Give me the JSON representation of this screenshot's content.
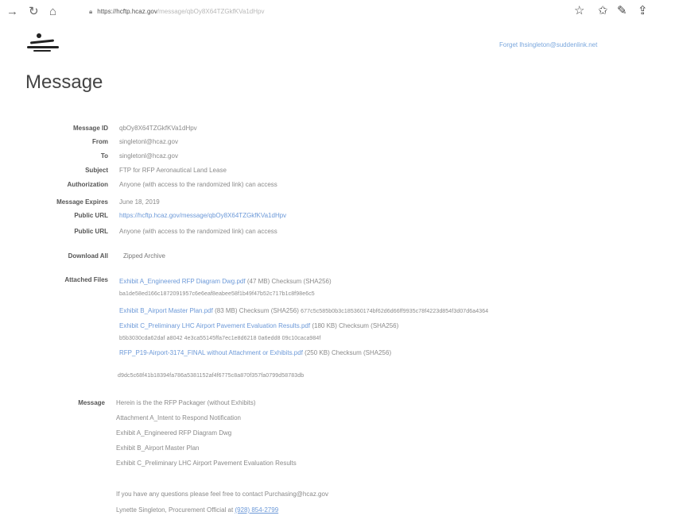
{
  "browser": {
    "url_host": "https://hcftp.hcaz.gov",
    "url_rest": "/message/qbOy8X64TZGkfKVa1dHpv"
  },
  "header": {
    "user_link": "Forget lhsingleton@suddenlink.net"
  },
  "page": {
    "title": "Message"
  },
  "fields": {
    "message_id": {
      "label": "Message ID",
      "value": "qbOy8X64TZGkfKVa1dHpv"
    },
    "from": {
      "label": "From",
      "value": "singletonl@hcaz.gov"
    },
    "to": {
      "label": "To",
      "value": "singletonl@hcaz.gov"
    },
    "subject": {
      "label": "Subject",
      "value": "FTP for RFP Aeronautical Land Lease"
    },
    "authorization": {
      "label": "Authorization",
      "value": "Anyone (with access to the randomized link) can access"
    },
    "expires": {
      "label": "Message Expires",
      "value": "June 18, 2019"
    },
    "public_url": {
      "label": "Public URL",
      "value": "https://hcftp.hcaz.gov/message/qbOy8X64TZGkfKVa1dHpv"
    },
    "public_url_2": {
      "label": "Public URL",
      "value": "Anyone (with access to the randomized link) can access"
    },
    "download_all": {
      "label": "Download All",
      "value": "Zipped Archive"
    }
  },
  "attached": {
    "label": "Attached Files",
    "files": [
      {
        "name": "Exhibit A_Engineered RFP Diagram Dwg.pdf",
        "meta": "(47 MB) Checksum (SHA256)",
        "hash": "ba1de58ed166c1872091957c6e6eaf8eabee58f1b49f47b52c717b1c8f98e6c5"
      },
      {
        "name": "Exhibit B_Airport Master Plan.pdf",
        "meta": "(83 MB) Checksum (SHA256)",
        "hash": "677c5c585b0b3c185360174bf62d6d66ff9935c78f4223d854f3d07d6a4364"
      },
      {
        "name": "Exhibit C_Preliminary LHC Airport Pavement Evaluation Results.pdf",
        "meta": "(180 KB) Checksum (SHA256)",
        "hash": "b5b3030cda62daf a8042 4e3ca55145ffa7ec1e8d6218 0a6edd8 09c10caca984f"
      },
      {
        "name": "RFP_P19-Airport-3174_FINAL without Attachment or Exhibits.pdf",
        "meta": "(250 KB) Checksum (SHA256)",
        "hash": "d9dc5c68f41b18394fa786a5381152af4f6775c8a870f357fa0799d58783db"
      }
    ]
  },
  "message": {
    "label": "Message",
    "lines": [
      "Herein is the the RFP Packager (without Exhibits)",
      "Attachment A_Intent to Respond Notification",
      "Exhibit A_Engineered RFP Diagram Dwg",
      "Exhibit B_Airport Master Plan",
      "Exhibit C_Preliminary LHC Airport Pavement Evaluation Results"
    ],
    "contact_line": "If you have any questions please feel free to contact Purchasing@hcaz.gov",
    "signature_prefix": "Lynette Singleton, Procurement Official at",
    "phone": "(928) 854-2799"
  },
  "icons": {
    "back": "arrow-right",
    "reload": "reload",
    "home": "home",
    "lock": "lock",
    "favorite": "star",
    "favorites": "star-list",
    "pen": "pen",
    "share": "share"
  }
}
